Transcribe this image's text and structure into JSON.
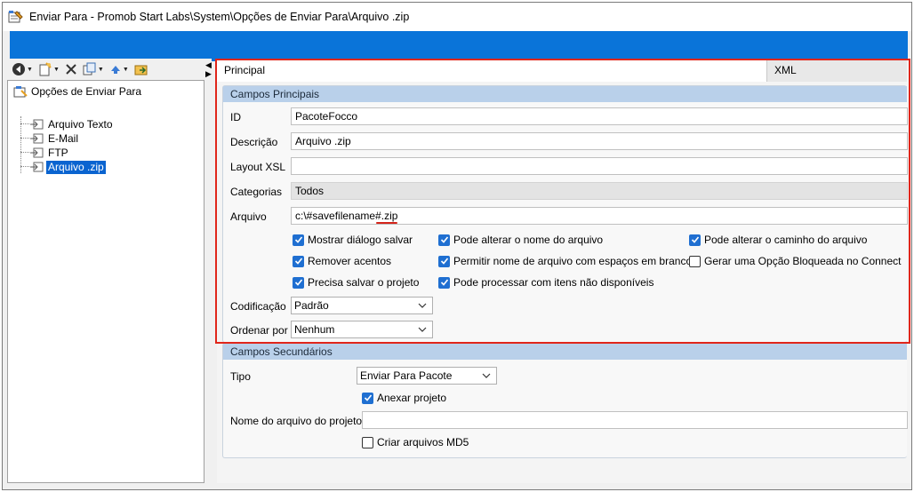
{
  "window": {
    "title": "Enviar Para - Promob Start Labs\\System\\Opções de Enviar Para\\Arquivo .zip"
  },
  "tree": {
    "root": "Opções de Enviar Para",
    "items": [
      "Arquivo Texto",
      "E-Mail",
      "FTP",
      "Arquivo .zip"
    ],
    "selected": "Arquivo .zip"
  },
  "tabs": [
    {
      "label": "Principal",
      "active": true
    },
    {
      "label": "XML",
      "active": false
    }
  ],
  "group_main": {
    "title": "Campos Principais",
    "id": {
      "label": "ID",
      "value": "PacoteFocco"
    },
    "descricao": {
      "label": "Descrição",
      "value": "Arquivo .zip"
    },
    "layout": {
      "label": "Layout XSL",
      "value": ""
    },
    "categorias": {
      "label": "Categorias",
      "value": "Todos"
    },
    "arquivo": {
      "label": "Arquivo",
      "value_prefix": "c:\\#savefilename#",
      "value_ext": ".zip"
    },
    "checkboxes": [
      {
        "label": "Mostrar diálogo salvar",
        "checked": true
      },
      {
        "label": "Pode alterar o nome do arquivo",
        "checked": true
      },
      {
        "label": "Pode alterar o caminho do arquivo",
        "checked": true
      },
      {
        "label": "Remover acentos",
        "checked": true
      },
      {
        "label": "Permitir nome de arquivo com espaços em branco",
        "checked": true
      },
      {
        "label": "Gerar uma Opção Bloqueada no Connect",
        "checked": false
      },
      {
        "label": "Precisa salvar o projeto",
        "checked": true
      },
      {
        "label": "Pode processar com itens não disponíveis",
        "checked": true
      }
    ],
    "codificacao": {
      "label": "Codificação",
      "value": "Padrão"
    },
    "ordenar": {
      "label": "Ordenar por",
      "value": "Nenhum"
    }
  },
  "group_secondary": {
    "title": "Campos Secundários",
    "tipo": {
      "label": "Tipo",
      "value": "Enviar Para Pacote"
    },
    "anexar": {
      "label": "Anexar projeto",
      "checked": true
    },
    "nome_arquivo": {
      "label": "Nome do arquivo do projeto",
      "value": ""
    },
    "md5": {
      "label": "Criar arquivos MD5",
      "checked": false
    }
  },
  "colors": {
    "accent_bar": "#0a74d9",
    "selection": "#0a64d0",
    "group_header": "#b9d0ea",
    "highlight_outline": "#e0261b",
    "checkbox": "#1f6fd1"
  }
}
